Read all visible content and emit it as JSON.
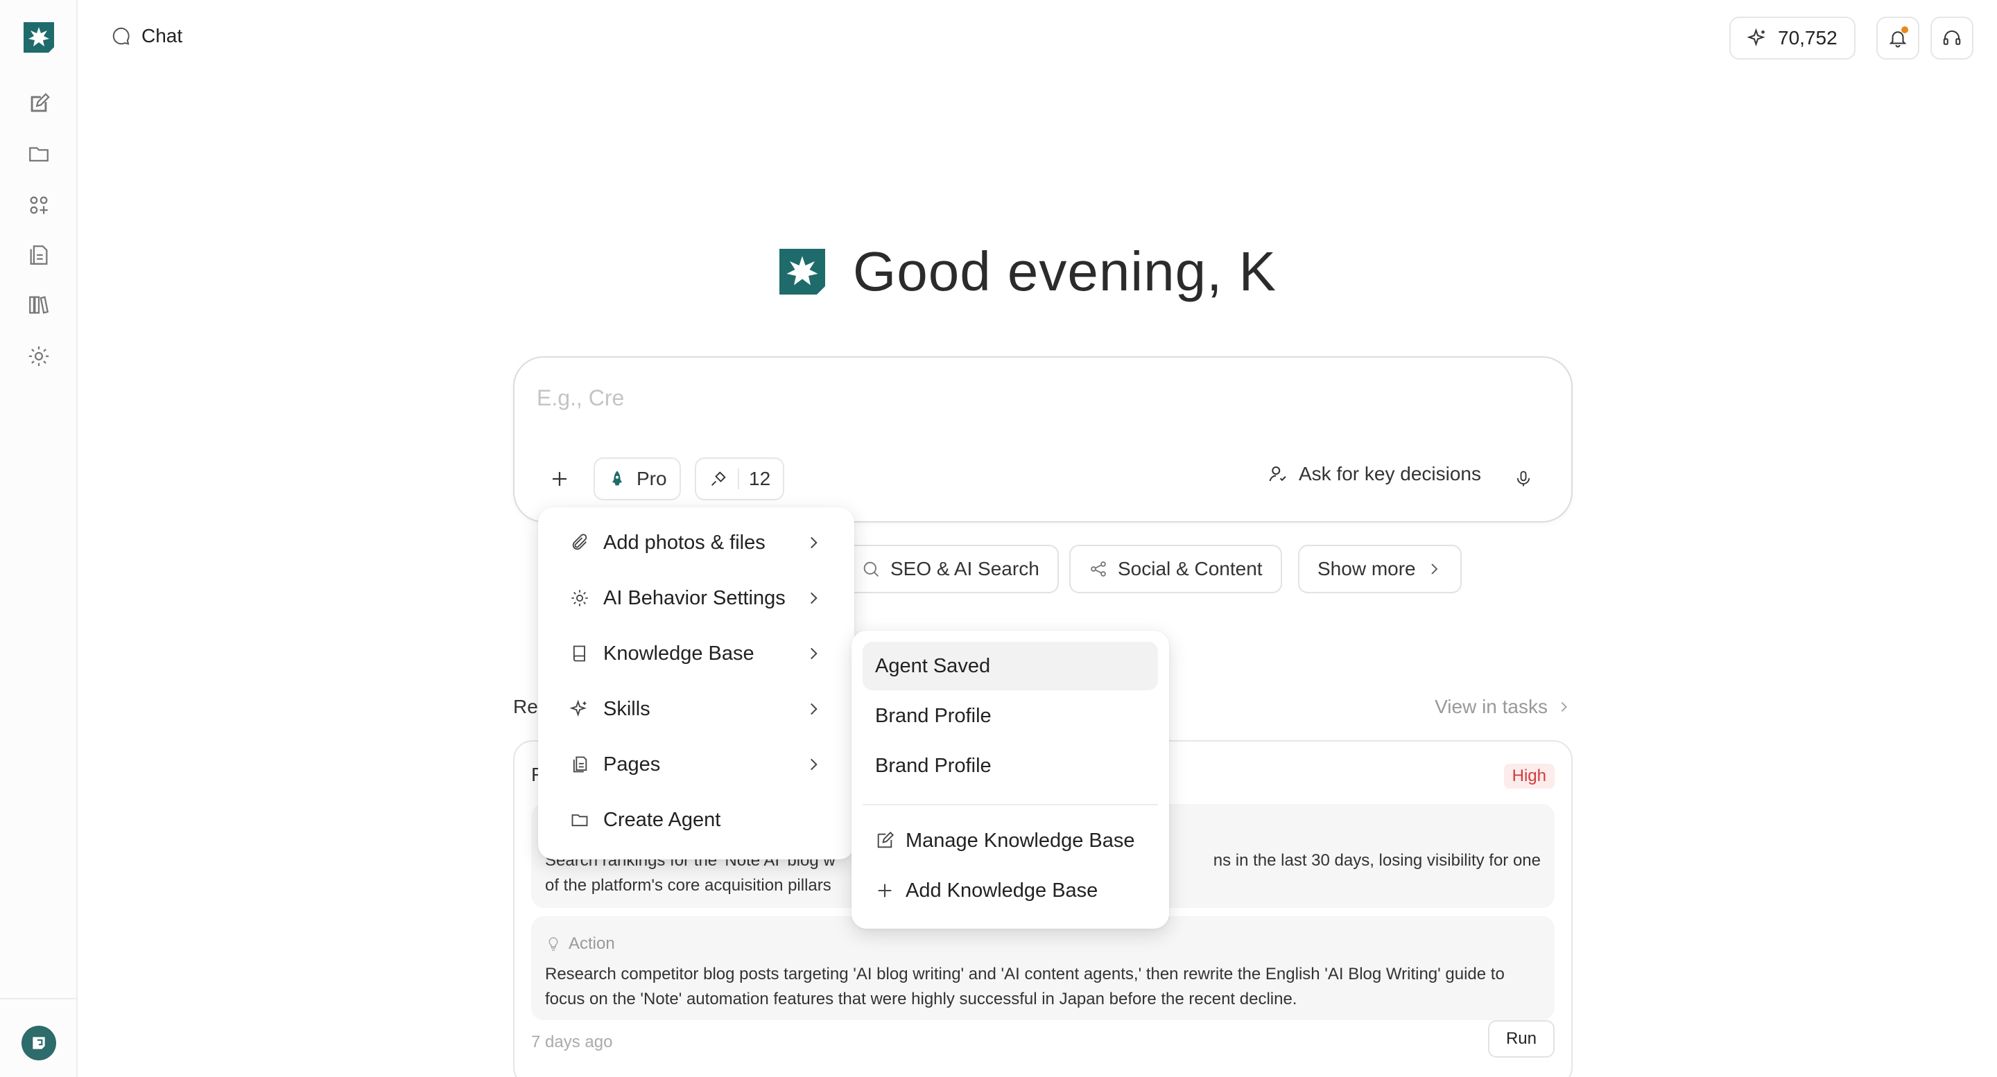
{
  "app": {
    "brand_color": "#1f6b6b",
    "page_tab": "Chat"
  },
  "sidebar": {
    "items": [
      {
        "icon": "edit-icon"
      },
      {
        "icon": "folder-icon"
      },
      {
        "icon": "apps-icon"
      },
      {
        "icon": "documents-icon"
      },
      {
        "icon": "library-icon"
      },
      {
        "icon": "settings-icon"
      }
    ]
  },
  "header": {
    "credits": "70,752"
  },
  "greeting": {
    "text": "Good evening, K"
  },
  "composer": {
    "placeholder": "E.g., Cre",
    "mode_label": "Pro",
    "tools_count": "12",
    "decisions_label": "Ask for key decisions"
  },
  "quick_pills": [
    {
      "label": "SEO & AI Search",
      "icon": "search-icon"
    },
    {
      "label": "Social & Content",
      "icon": "share-icon"
    },
    {
      "label": "Show more",
      "icon": "chevron-right-icon"
    }
  ],
  "recent": {
    "label": "Re",
    "view_link": "View in tasks"
  },
  "task_card": {
    "title": "F",
    "priority": "High",
    "issue_text_left": "Search rankings for the 'Note AI' blog w",
    "issue_text_right": "ns in the last 30 days, losing visibility for one",
    "issue_line2": "of the platform's core acquisition pillars",
    "action_label": "Action",
    "action_text": "Research competitor blog posts targeting 'AI blog writing' and 'AI content agents,' then rewrite the English 'AI Blog Writing' guide to focus on the 'Note' automation features that were highly successful in Japan before the recent decline.",
    "time": "7 days ago",
    "run_label": "Run"
  },
  "plus_menu": {
    "items": [
      {
        "label": "Add photos & files",
        "icon": "paperclip-icon",
        "has_submenu": true
      },
      {
        "label": "AI Behavior Settings",
        "icon": "gear-icon",
        "has_submenu": true
      },
      {
        "label": "Knowledge Base",
        "icon": "book-icon",
        "has_submenu": true
      },
      {
        "label": "Skills",
        "icon": "sparkle-icon",
        "has_submenu": true
      },
      {
        "label": "Pages",
        "icon": "pages-icon",
        "has_submenu": true
      },
      {
        "label": "Create Agent",
        "icon": "folder-icon",
        "has_submenu": false
      }
    ]
  },
  "kb_submenu": {
    "items": [
      {
        "label": "Agent Saved"
      },
      {
        "label": "Brand Profile"
      },
      {
        "label": "Brand Profile"
      }
    ],
    "actions": [
      {
        "label": "Manage Knowledge Base",
        "icon": "edit-icon"
      },
      {
        "label": "Add Knowledge Base",
        "icon": "plus-icon"
      }
    ]
  }
}
